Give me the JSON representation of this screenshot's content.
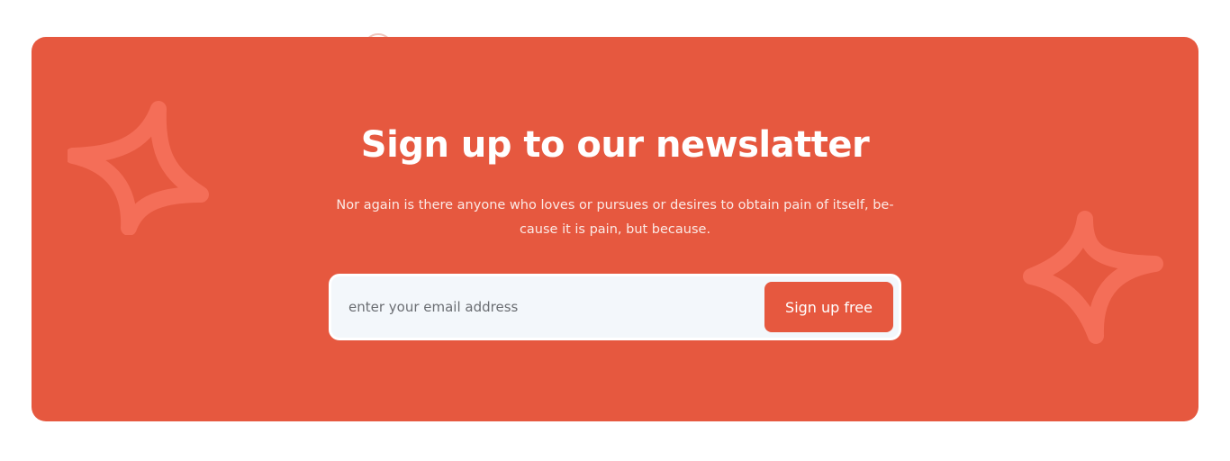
{
  "newsletter": {
    "title": "Sign up to our newslatter",
    "description": "Nor again is there anyone who loves or pursues or desires to obtain pain of itself, be-cause it is pain, but because.",
    "email_placeholder": "enter your email address",
    "submit_label": "Sign up free"
  },
  "colors": {
    "banner_background": "#e6583f",
    "sparkle": "#f46e58",
    "input_background": "#f3f7fb",
    "text_light": "#ffffff"
  },
  "icons": {
    "sparkle_left": "sparkle-icon",
    "sparkle_right": "sparkle-icon",
    "decorative_circle": "circle-outline-icon"
  }
}
